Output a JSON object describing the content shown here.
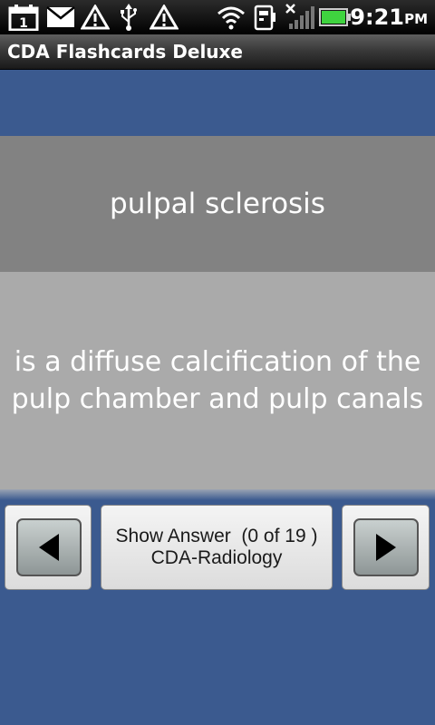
{
  "status_bar": {
    "time": "9:21",
    "ampm": "PM",
    "calendar_day": "1",
    "icons": [
      "calendar-icon",
      "email-icon",
      "warning-icon",
      "usb-icon",
      "warning-icon",
      "wifi-icon",
      "phone-storage-icon",
      "no-signal-icon",
      "battery-icon"
    ],
    "battery_color": "#3fd33f"
  },
  "app": {
    "title": "CDA Flashcards Deluxe"
  },
  "card": {
    "term": "pulpal sclerosis",
    "definition_line1": "is a diffuse calcification of the",
    "definition_line2": "pulp chamber and pulp canals"
  },
  "controls": {
    "show_answer_label": "Show Answer  (0 of 19 )",
    "deck_name": "CDA-Radiology",
    "prev_icon": "left-arrow-icon",
    "next_icon": "right-arrow-icon"
  },
  "colors": {
    "background_blue": "#3b5a8f",
    "term_panel": "#828282",
    "definition_panel": "#aaaaaa"
  }
}
